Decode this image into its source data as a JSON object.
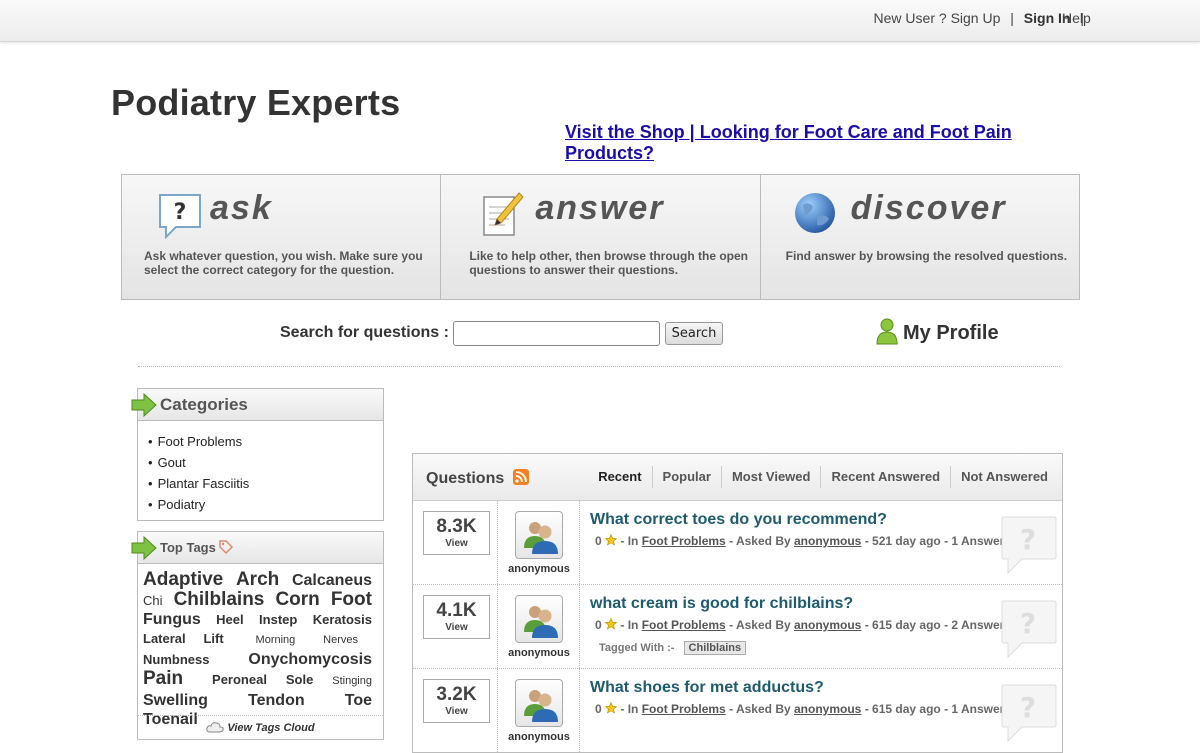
{
  "topbar": {
    "new_user": "New User ?",
    "sign_up": "Sign Up",
    "sign_in": "Sign In",
    "help": "Help",
    "sep": "|"
  },
  "site": {
    "title": "Podiatry Experts",
    "shop_link": "Visit the Shop | Looking for Foot Care and Foot Pain Products?"
  },
  "features": [
    {
      "title": "ask",
      "desc": "Ask whatever question, you wish. Make sure you select the correct category for the question."
    },
    {
      "title": "answer",
      "desc": "Like to help other, then browse through the open questions to answer their questions."
    },
    {
      "title": "discover",
      "desc": "Find answer by browsing the resolved questions."
    }
  ],
  "search": {
    "label": "Search for questions :",
    "button": "Search",
    "value": ""
  },
  "profile": {
    "label": "My Profile"
  },
  "categories": {
    "title": "Categories",
    "items": [
      "Foot Problems",
      "Gout",
      "Plantar Fasciitis",
      "Podiatry"
    ]
  },
  "tags": {
    "title": "Top Tags",
    "items": [
      "Adaptive",
      "Arch",
      "Calcaneus",
      "Chi",
      "Chilblains",
      "Corn",
      "Foot",
      "Fungus",
      "Heel",
      "Instep",
      "Keratosis",
      "Lateral",
      "Lift",
      "Morning",
      "Nerves",
      "Numbness",
      "Onychomycosis",
      "Pain",
      "Peroneal",
      "Sole",
      "Stinging",
      "Swelling",
      "Tendon",
      "Toe",
      "Toenail"
    ],
    "footer": "View Tags Cloud"
  },
  "questions": {
    "title": "Questions",
    "tabs": [
      "Recent",
      "Popular",
      "Most Viewed",
      "Recent Answered",
      "Not Answered"
    ],
    "view_label": "View",
    "rows": [
      {
        "views": "8.3K",
        "user": "anonymous",
        "title": "What correct toes do you recommend?",
        "score": "0",
        "category": "Foot Problems",
        "asked_by": "anonymous",
        "age": "521 day ago",
        "answers": "1 Answer",
        "tags": []
      },
      {
        "views": "4.1K",
        "user": "anonymous",
        "title": "what cream is good for chilblains?",
        "score": "0",
        "category": "Foot Problems",
        "asked_by": "anonymous",
        "age": "615 day ago",
        "answers": "2 Answer",
        "tags": [
          "Chilblains"
        ]
      },
      {
        "views": "3.2K",
        "user": "anonymous",
        "title": "What shoes for met adductus?",
        "score": "0",
        "category": "Foot Problems",
        "asked_by": "anonymous",
        "age": "615 day ago",
        "answers": "1 Answer",
        "tags": []
      }
    ],
    "meta": {
      "in": "- In",
      "asked_by": "- Asked By",
      "dash": "-",
      "tagged_with": "Tagged With :-"
    }
  }
}
